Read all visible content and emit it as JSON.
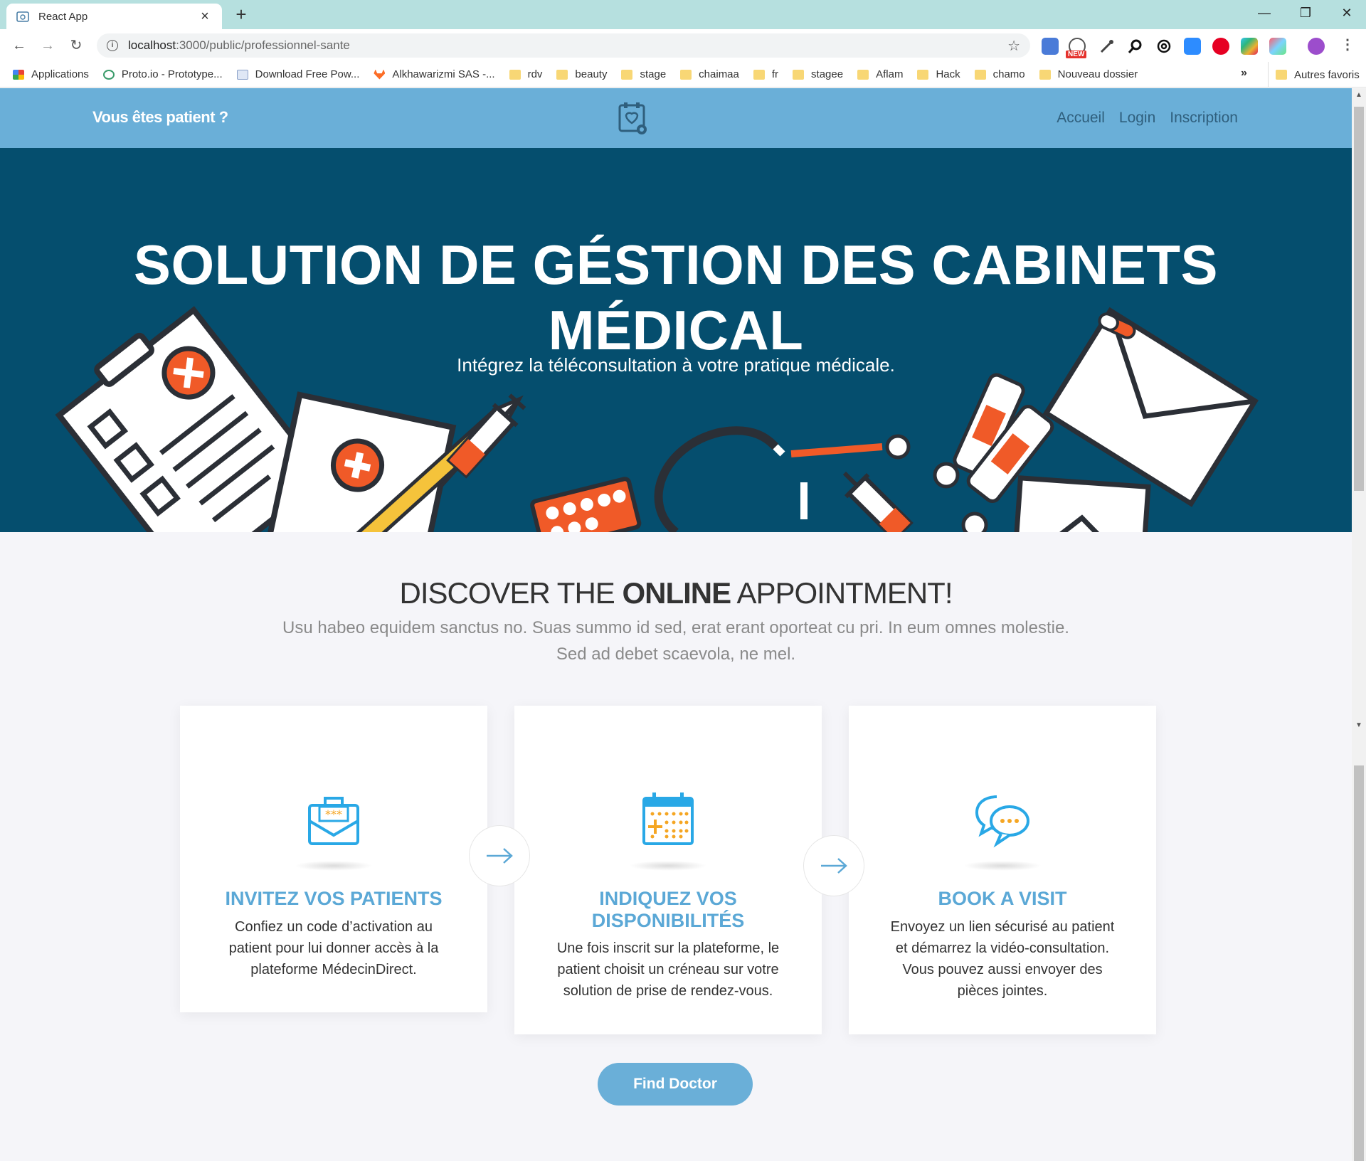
{
  "browser": {
    "tab_title": "React App",
    "url_host": "localhost",
    "url_path": ":3000/public/professionnel-sante",
    "extension_badge": "NEW",
    "bookmarks": [
      {
        "label": "Applications",
        "icon": "apps-grid-icon"
      },
      {
        "label": "Proto.io - Prototype...",
        "icon": "protoio-icon"
      },
      {
        "label": "Download Free Pow...",
        "icon": "page-icon"
      },
      {
        "label": "Alkhawarizmi SAS -...",
        "icon": "gitlab-icon"
      },
      {
        "label": "rdv",
        "icon": "folder-icon"
      },
      {
        "label": "beauty",
        "icon": "folder-icon"
      },
      {
        "label": "stage",
        "icon": "folder-icon"
      },
      {
        "label": "chaimaa",
        "icon": "folder-icon"
      },
      {
        "label": "fr",
        "icon": "folder-icon"
      },
      {
        "label": "stagee",
        "icon": "folder-icon"
      },
      {
        "label": "Aflam",
        "icon": "folder-icon"
      },
      {
        "label": "Hack",
        "icon": "folder-icon"
      },
      {
        "label": "chamo",
        "icon": "folder-icon"
      },
      {
        "label": "Nouveau dossier",
        "icon": "folder-icon"
      }
    ],
    "bookmarks_more": "»",
    "other_bookmarks": "Autres favoris"
  },
  "header": {
    "patient_link": "Vous êtes patient ?",
    "nav": [
      "Accueil",
      "Login",
      "Inscription"
    ]
  },
  "hero": {
    "title_line1": "SOLUTION DE GÉSTION DES CABINETS",
    "title_line2": "MÉDICAL",
    "subtitle": "Intégrez la téléconsultation à votre pratique médicale."
  },
  "discover": {
    "title_pre": "DISCOVER THE ",
    "title_bold": "ONLINE",
    "title_post": " APPOINTMENT!",
    "text_line1": "Usu habeo equidem sanctus no. Suas summo id sed, erat erant oporteat cu pri. In eum omnes molestie.",
    "text_line2": "Sed ad debet scaevola, ne mel."
  },
  "steps": [
    {
      "icon": "envelope-code-icon",
      "title_lines": [
        "INVITEZ VOS PATIENTS"
      ],
      "text_lines": [
        "Confiez un code d’activation au",
        "patient pour lui donner accès à la",
        "plateforme MédecinDirect."
      ]
    },
    {
      "icon": "calendar-icon",
      "title_lines": [
        "INDIQUEZ VOS",
        "DISPONIBILITÉS"
      ],
      "text_lines": [
        "Une fois inscrit sur la plateforme, le",
        "patient choisit un créneau sur votre",
        "solution de prise de rendez-vous."
      ]
    },
    {
      "icon": "chat-bubbles-icon",
      "title_lines": [
        "BOOK A VISIT"
      ],
      "text_lines": [
        "Envoyez un lien sécurisé au patient",
        "et démarrez la vidéo-consultation.",
        "Vous pouvez aussi envoyer des",
        "pièces jointes."
      ]
    }
  ],
  "cta": {
    "label": "Find Doctor"
  },
  "colors": {
    "header": "#6aafd8",
    "hero": "#054e6e",
    "accent": "#5ba8d6",
    "orange": "#f05a28"
  }
}
